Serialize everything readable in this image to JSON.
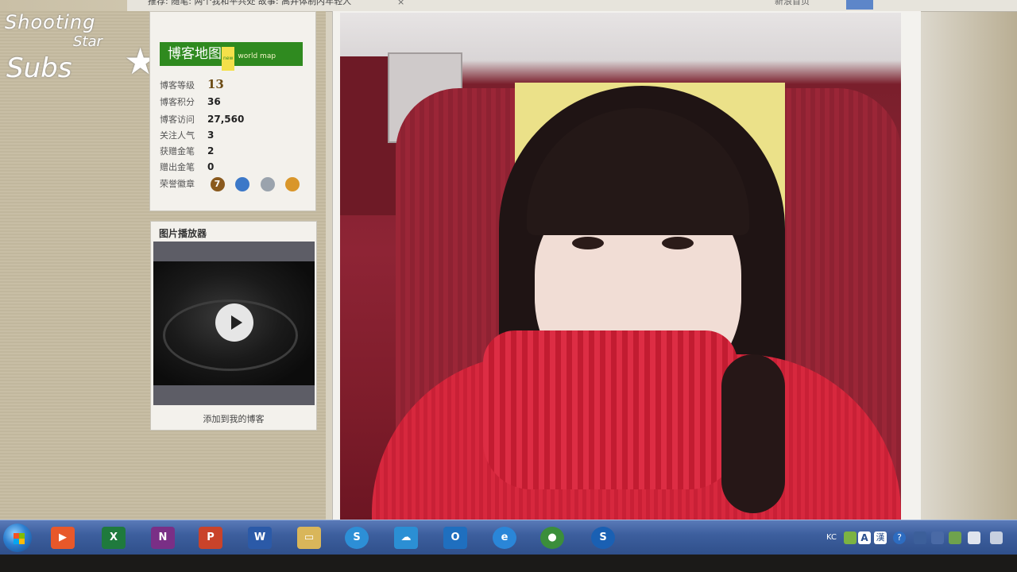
{
  "browser_top": {
    "news_text": "推荐: 随笔: 两个我和平共处  故事: 高井体制内年轻人",
    "close_glyph": "×",
    "right_text": "新浪首页"
  },
  "watermark": {
    "line1": "Shooting",
    "line2": "Star",
    "line3": "Subs",
    "star": "★"
  },
  "blog_sidebar": {
    "map_button": {
      "label": "博客地图",
      "tag": "new",
      "sub": "world map"
    },
    "stats": [
      {
        "label": "博客等级",
        "value": "13"
      },
      {
        "label": "博客积分",
        "value": "36"
      },
      {
        "label": "博客访问",
        "value": "27,560"
      },
      {
        "label": "关注人气",
        "value": "3"
      },
      {
        "label": "获赠金笔",
        "value": "2"
      },
      {
        "label": "赠出金笔",
        "value": "0"
      },
      {
        "label": "荣誉徽章",
        "value": ""
      }
    ],
    "badges": [
      {
        "icon": "medal-7-icon",
        "text": "7",
        "color": "#8a5a1e"
      },
      {
        "icon": "camera-icon",
        "text": "",
        "color": "#3c78c8"
      },
      {
        "icon": "lock-icon",
        "text": "",
        "color": "#9aa3ad"
      },
      {
        "icon": "pen-icon",
        "text": "",
        "color": "#d9962a"
      }
    ]
  },
  "player": {
    "title": "图片播放器",
    "add_link": "添加到我的博客",
    "play_icon": "play-icon"
  },
  "taskbar": {
    "apps": [
      {
        "name": "media-player",
        "glyph": "▶",
        "color": "#e8582a"
      },
      {
        "name": "excel",
        "glyph": "X",
        "color": "#1f7a3d"
      },
      {
        "name": "onenote",
        "glyph": "N",
        "color": "#7a2f86"
      },
      {
        "name": "powerpoint",
        "glyph": "P",
        "color": "#c9432a"
      },
      {
        "name": "word",
        "glyph": "W",
        "color": "#2b5aa8"
      },
      {
        "name": "file-explorer",
        "glyph": "▭",
        "color": "#d9b65a"
      },
      {
        "name": "sogou",
        "glyph": "S",
        "color": "#2d8fd6"
      },
      {
        "name": "baidu-cloud",
        "glyph": "☁",
        "color": "#2b8fd4"
      },
      {
        "name": "outlook",
        "glyph": "O",
        "color": "#1f6fbf"
      },
      {
        "name": "internet-explorer",
        "glyph": "e",
        "color": "#2a86d8"
      },
      {
        "name": "chrome",
        "glyph": "●",
        "color": "#3b8e3b"
      },
      {
        "name": "sogou-browser",
        "glyph": "S",
        "color": "#1a60b3"
      }
    ],
    "tray": {
      "lang": "KC",
      "ime_a": "A",
      "ime_b": "漢",
      "help": "?"
    }
  }
}
